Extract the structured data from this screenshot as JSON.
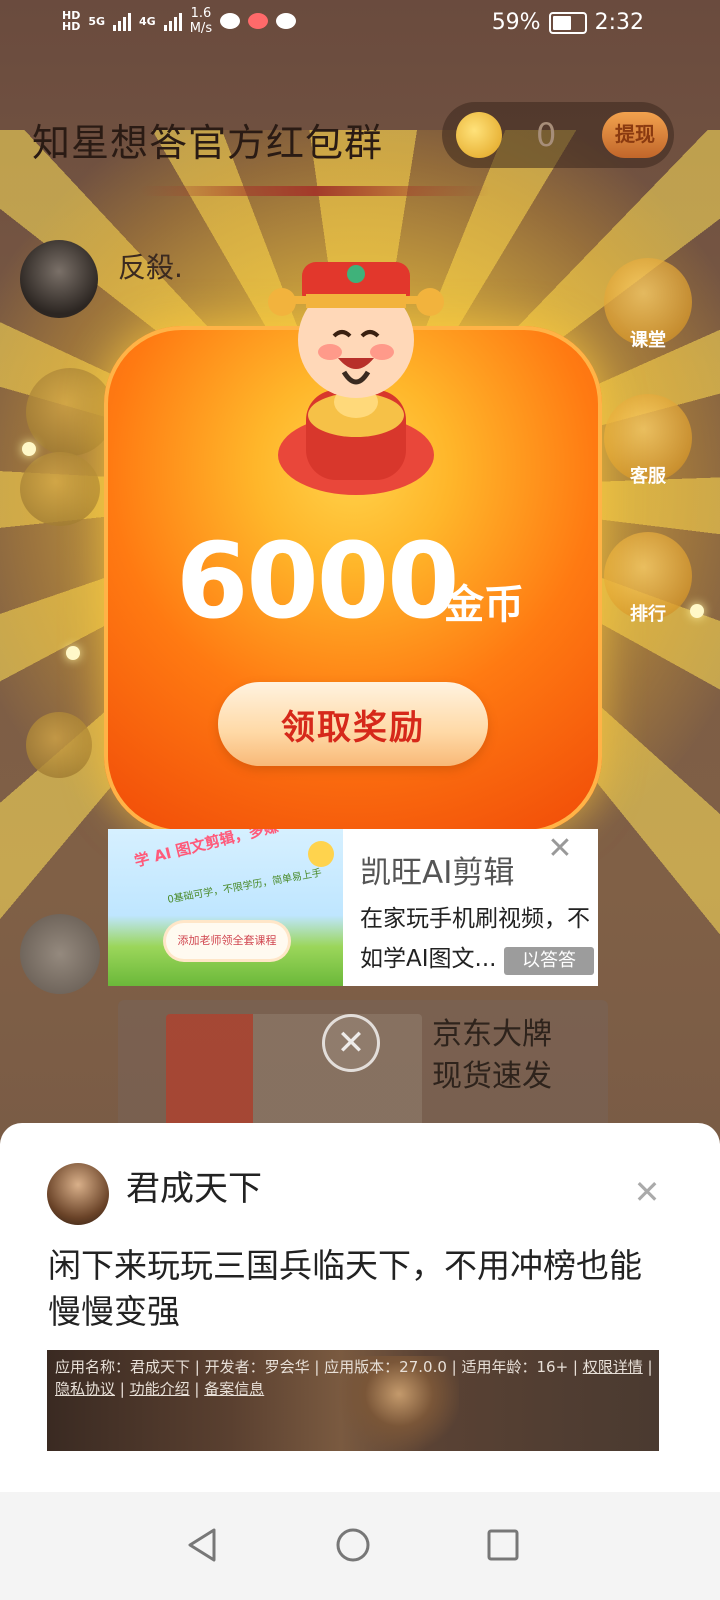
{
  "status_bar": {
    "hd1": "HD",
    "net_5g": "5G",
    "net_4g": "4G",
    "speed_value": "1.6",
    "speed_unit": "M/s",
    "battery": "59%",
    "time": "2:32"
  },
  "header": {
    "title": "知星想答官方红包群",
    "coins": "0",
    "withdraw_label": "提现"
  },
  "chat": {
    "sender": "反殺."
  },
  "side_buttons": [
    {
      "label": "课堂"
    },
    {
      "label": "客服"
    },
    {
      "label": "排行"
    }
  ],
  "background_ad": {
    "text_line1": "京东大牌",
    "text_line2": "现货速发"
  },
  "reward_modal": {
    "amount": "6000",
    "unit": "金币",
    "claim_label": "领取奖励",
    "close_glyph": "✕"
  },
  "banner_ad": {
    "image_title": "学 AI 图文剪辑，多赚一份收入",
    "image_sub": "0基础可学，不限学历，简单易上手",
    "image_button": "添加老师领全套课程",
    "title": "凯旺AI剪辑",
    "description": "在家玩手机刷视频，不如学AI图文...",
    "tag": "以答答"
  },
  "bottom_sheet": {
    "app_name": "君成天下",
    "message": "闲下来玩玩三国兵临天下，不用冲榜也能慢慢变强",
    "info_prefix": "应用名称：君成天下 | 开发者：罗会华 | 应用版本：27.0.0 | 适用年龄：16+ | ",
    "permissions_link": "权限详情",
    "privacy_link": "隐私协议",
    "features_link": "功能介绍",
    "filing_link": "备案信息"
  },
  "colors": {
    "packet_orange": "#f04a08",
    "claim_text": "#d6281a",
    "sheet_bg": "#ffffff"
  },
  "icons": {
    "back": "back-triangle-icon",
    "home": "home-circle-icon",
    "recents": "recents-square-icon",
    "close": "close-icon"
  }
}
